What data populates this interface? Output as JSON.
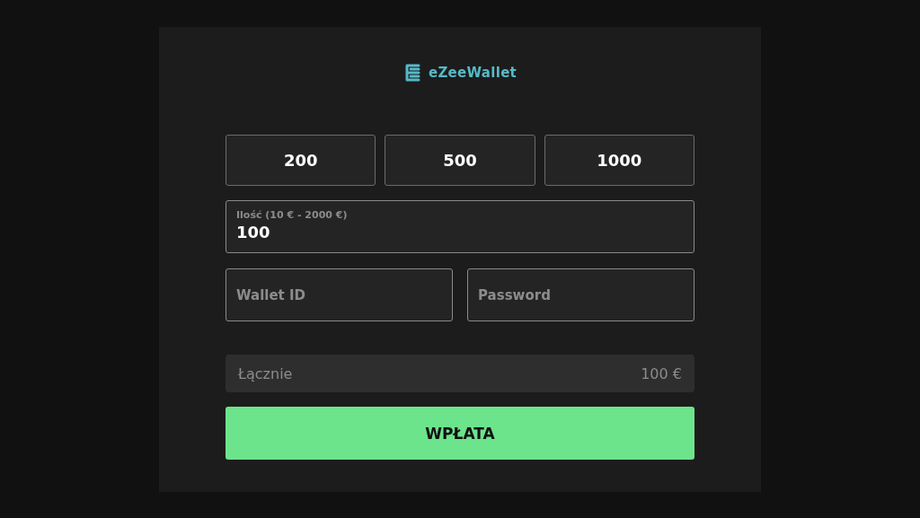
{
  "logo": {
    "text": "eZeeWallet"
  },
  "presets": [
    {
      "label": "200"
    },
    {
      "label": "500"
    },
    {
      "label": "1000"
    }
  ],
  "amount": {
    "label": "Ilość (10 € - 2000 €)",
    "value": "100"
  },
  "fields": [
    {
      "placeholder": "Wallet ID"
    },
    {
      "placeholder": "Password"
    }
  ],
  "total": {
    "label": "Łącznie",
    "value": "100 €"
  },
  "submit": {
    "label": "WPŁATA"
  }
}
